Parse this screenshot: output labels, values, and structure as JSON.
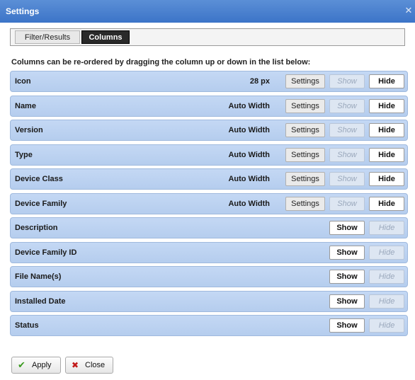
{
  "window": {
    "title": "Settings",
    "close_glyph": "✕"
  },
  "tabs": [
    {
      "label": "Filter/Results",
      "active": false
    },
    {
      "label": "Columns",
      "active": true
    }
  ],
  "instructions": "Columns can be re-ordered by dragging the column up or down in the list below:",
  "columns": [
    {
      "label": "Icon",
      "width": "28 px",
      "settings": "Settings",
      "show": "Show",
      "hide": "Hide",
      "visible": true
    },
    {
      "label": "Name",
      "width": "Auto Width",
      "settings": "Settings",
      "show": "Show",
      "hide": "Hide",
      "visible": true
    },
    {
      "label": "Version",
      "width": "Auto Width",
      "settings": "Settings",
      "show": "Show",
      "hide": "Hide",
      "visible": true
    },
    {
      "label": "Type",
      "width": "Auto Width",
      "settings": "Settings",
      "show": "Show",
      "hide": "Hide",
      "visible": true
    },
    {
      "label": "Device Class",
      "width": "Auto Width",
      "settings": "Settings",
      "show": "Show",
      "hide": "Hide",
      "visible": true
    },
    {
      "label": "Device Family",
      "width": "Auto Width",
      "settings": "Settings",
      "show": "Show",
      "hide": "Hide",
      "visible": true
    },
    {
      "label": "Description",
      "show": "Show",
      "hide": "Hide",
      "visible": false
    },
    {
      "label": "Device Family ID",
      "show": "Show",
      "hide": "Hide",
      "visible": false
    },
    {
      "label": "File Name(s)",
      "show": "Show",
      "hide": "Hide",
      "visible": false
    },
    {
      "label": "Installed Date",
      "show": "Show",
      "hide": "Hide",
      "visible": false
    },
    {
      "label": "Status",
      "show": "Show",
      "hide": "Hide",
      "visible": false
    }
  ],
  "footer": {
    "apply_label": "Apply",
    "close_label": "Close",
    "apply_icon": "checkmark-icon",
    "close_icon": "x-icon"
  },
  "colors": {
    "titlebar": "#3c74c8",
    "row": "#c4d8f4",
    "active_tab": "#2a2a2a"
  }
}
